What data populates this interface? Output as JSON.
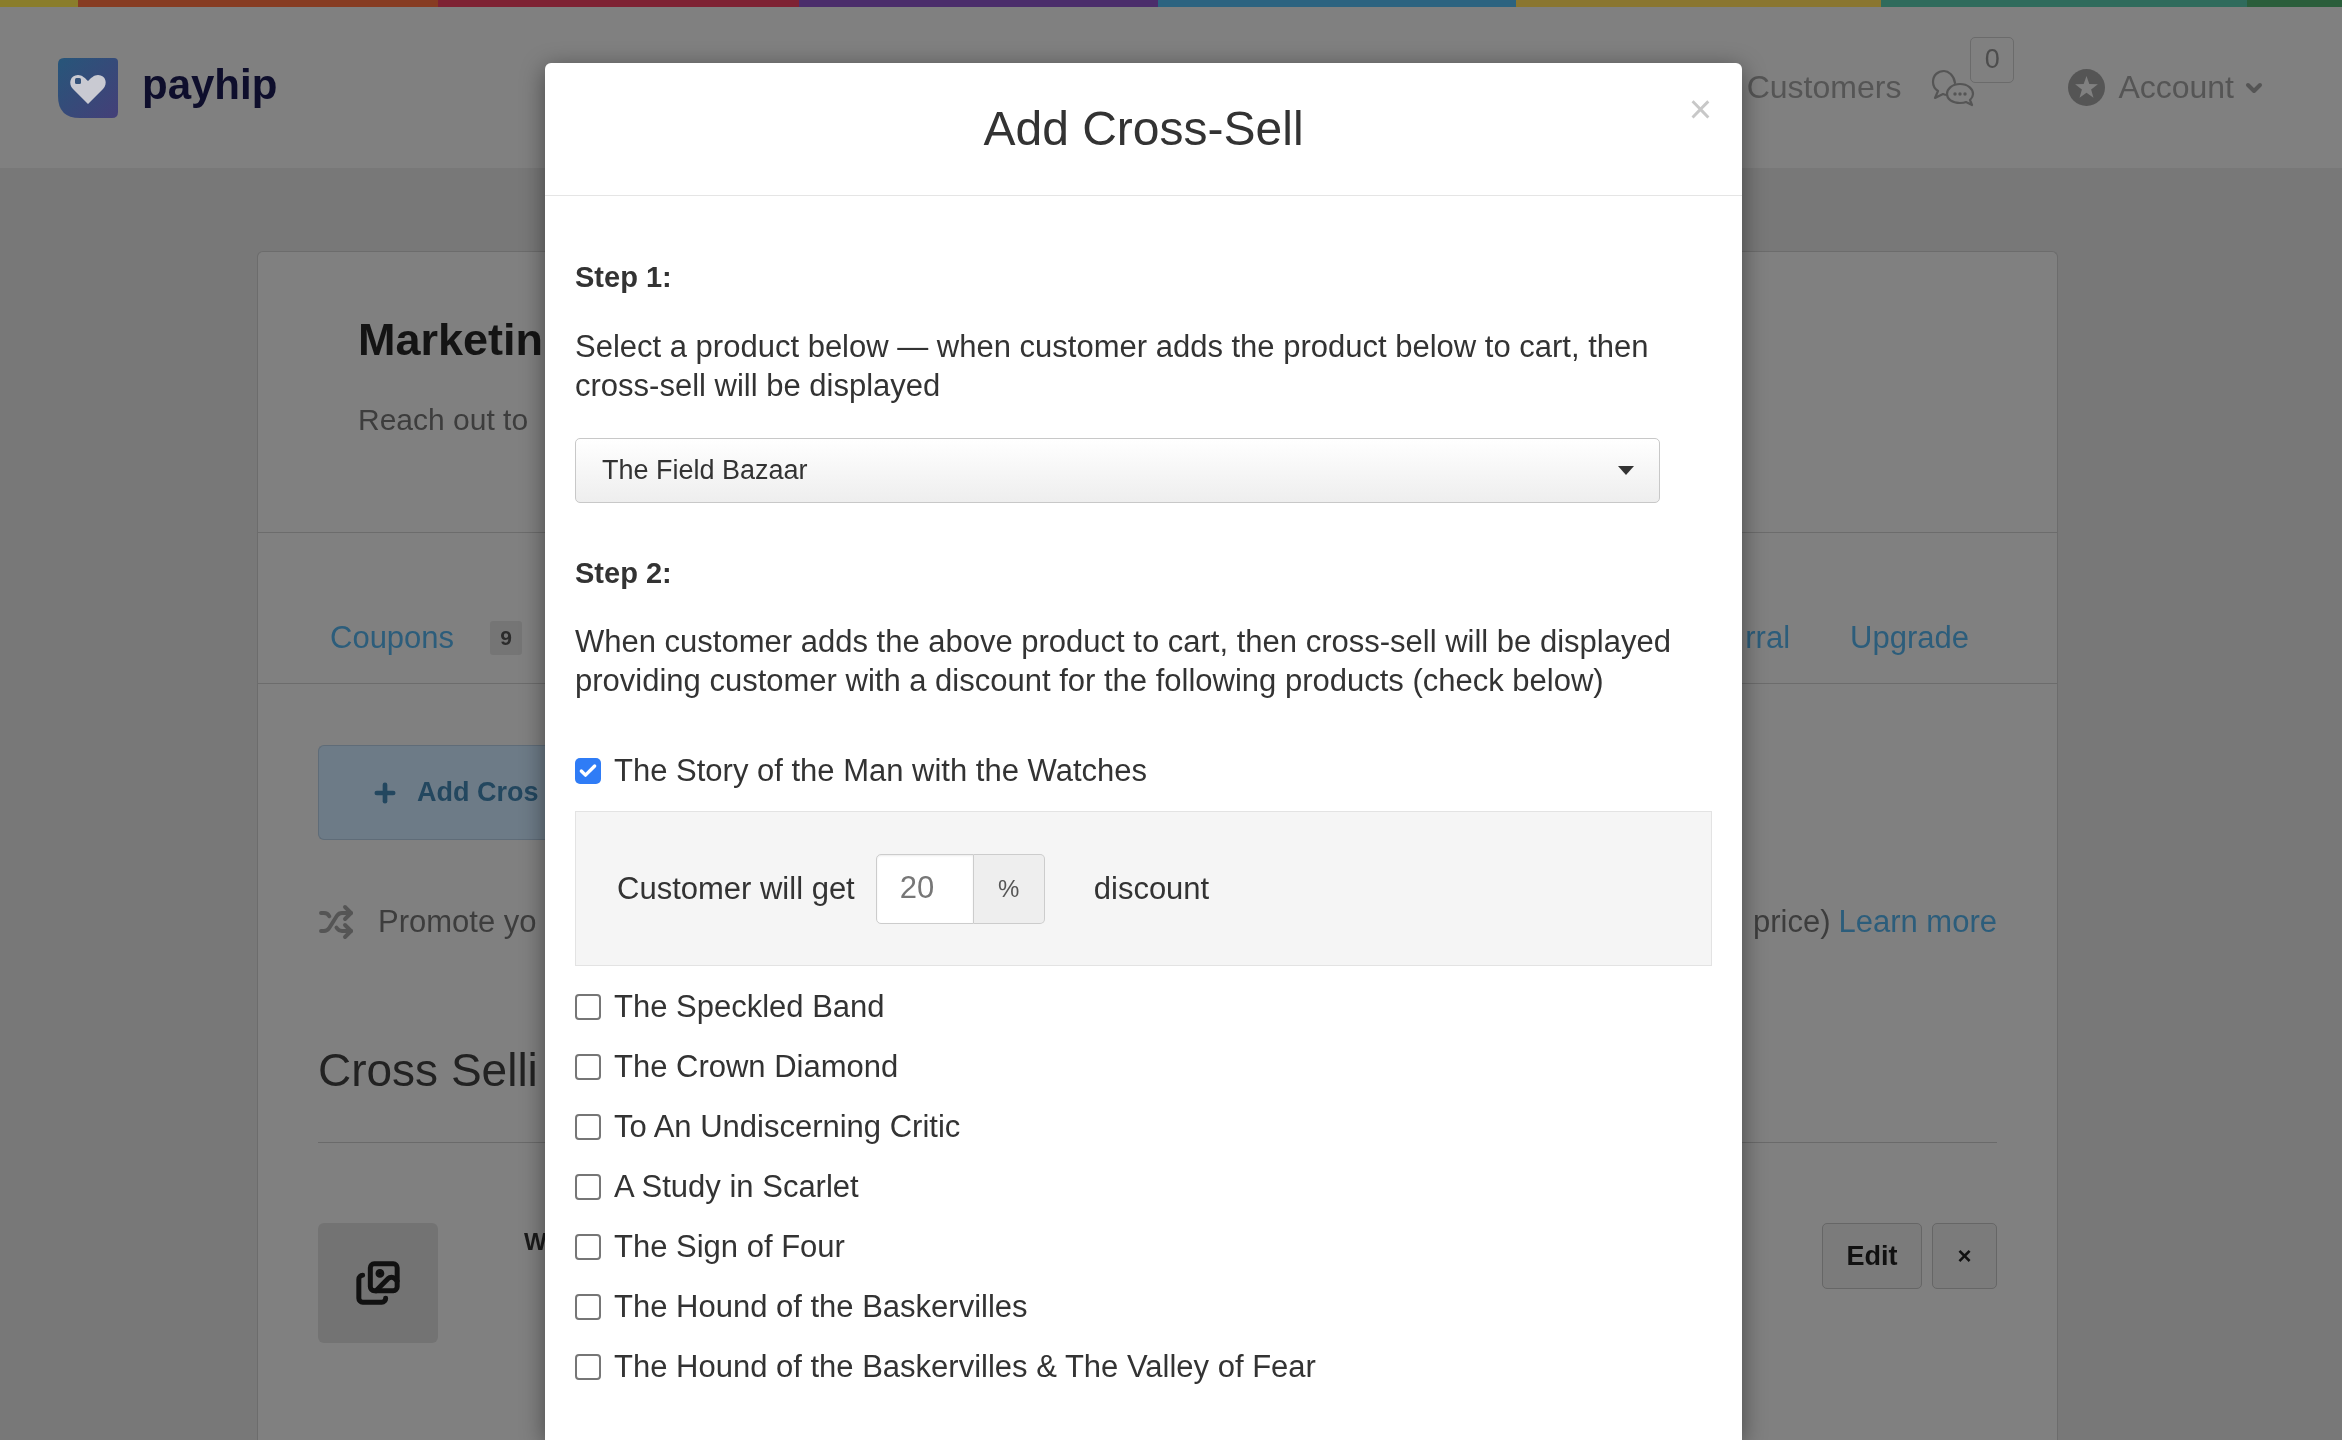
{
  "header": {
    "logo_text": "payhip",
    "nav": [
      {
        "label": "Customers"
      }
    ],
    "messages": {
      "count": "0"
    },
    "account": {
      "label": "Account"
    }
  },
  "page": {
    "title": "Marketin",
    "subtitle": "Reach out to",
    "tabs": [
      {
        "label": "Coupons",
        "count": "9"
      },
      {
        "label": "rral"
      },
      {
        "label": "Upgrade"
      }
    ],
    "add_button": {
      "label": "Add Cros"
    },
    "info": {
      "text": "Promote yo",
      "text_end": "price)",
      "link": "Learn more"
    },
    "section_title": "Cross Selli",
    "items": [
      {
        "title": "W",
        "actions": [
          {
            "kind": "edit",
            "label": "Edit"
          },
          {
            "kind": "delete",
            "label": "×"
          }
        ]
      }
    ]
  },
  "modal": {
    "title": "Add Cross-Sell",
    "close": "×",
    "step_1": {
      "heading": "Step 1:",
      "text": "Select a product below — when customer adds the product below to cart, then cross-sell will be displayed",
      "select": {
        "value": "The Field Bazaar"
      }
    },
    "step_2": {
      "heading": "Step 2:",
      "text": "When customer adds the above product to cart, then cross-sell will be displayed providing customer with a discount for the following products (check below)",
      "products": [
        {
          "label": "The Story of the Man with the Watches",
          "checked": true,
          "discount": {
            "label": "Customer will get",
            "value": "20",
            "unit": "%",
            "suffix": "discount"
          }
        },
        {
          "label": "The Speckled Band",
          "checked": false
        },
        {
          "label": "The Crown Diamond",
          "checked": false
        },
        {
          "label": "To An Undiscerning Critic",
          "checked": false
        },
        {
          "label": "A Study in Scarlet",
          "checked": false
        },
        {
          "label": "The Sign of Four",
          "checked": false
        },
        {
          "label": "The Hound of the Baskervilles",
          "checked": false
        },
        {
          "label": "The Hound of the Baskervilles & The Valley of Fear",
          "checked": false
        }
      ]
    }
  }
}
